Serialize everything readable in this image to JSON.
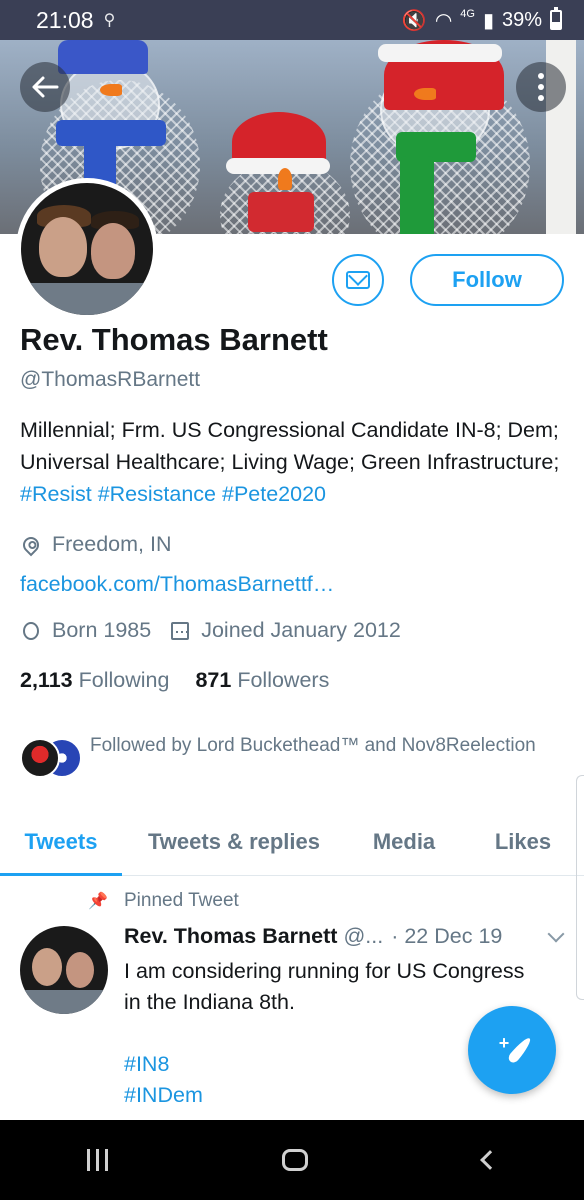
{
  "status_bar": {
    "time": "21:08",
    "network": "4G",
    "battery": "39%"
  },
  "profile": {
    "name": "Rev. Thomas Barnett",
    "handle": "@ThomasRBarnett",
    "follow_label": "Follow",
    "bio_text": "Millennial; Frm. US Congressional Candidate IN-8; Dem; Universal Healthcare; Living Wage; Green Infrastructure;",
    "bio_hashtags": [
      "#Resist",
      "#Resistance",
      "#Pete2020"
    ],
    "location": "Freedom, IN",
    "website": "facebook.com/ThomasBarnettf…",
    "born": "Born 1985",
    "joined": "Joined January 2012",
    "following_count": "2,113",
    "following_label": "Following",
    "followers_count": "871",
    "followers_label": "Followers",
    "followed_by": "Followed by Lord Buckethead™ and Nov8Reelection"
  },
  "tabs": [
    "Tweets",
    "Tweets & replies",
    "Media",
    "Likes"
  ],
  "pinned_tweet": {
    "pinned_label": "Pinned Tweet",
    "author": "Rev. Thomas Barnett",
    "handle": "@...",
    "date": "· 22 Dec 19",
    "text": "I am considering running for US Congress in the Indiana 8th.",
    "hashtags": [
      "#IN8",
      "#INDem"
    ]
  },
  "colors": {
    "accent": "#1da1f2",
    "link": "#1b95e0",
    "muted": "#657786",
    "status_bar": "#3a3f55"
  },
  "icons": {
    "back": "arrow-left-icon",
    "more": "more-vertical-icon",
    "message": "envelope-icon",
    "location": "location-pin-icon",
    "birthday": "balloon-icon",
    "joined": "calendar-icon",
    "compose": "compose-tweet-icon"
  }
}
